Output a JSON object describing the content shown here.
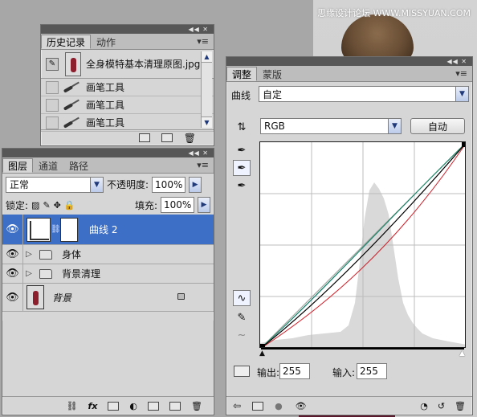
{
  "watermark": "思缘设计论坛 WWW.MISSYUAN.COM",
  "history": {
    "tabs": [
      "历史记录",
      "动作"
    ],
    "snapshot_name": "全身模特基本清理原图.jpg",
    "items": [
      "画笔工具",
      "画笔工具",
      "画笔工具"
    ]
  },
  "layers": {
    "tabs": [
      "图层",
      "通道",
      "路径"
    ],
    "blend_mode": "正常",
    "opacity_label": "不透明度:",
    "opacity_value": "100%",
    "lock_label": "锁定:",
    "fill_label": "填充:",
    "fill_value": "100%",
    "items": [
      {
        "name": "曲线 2",
        "kind": "adjustment",
        "selected": true
      },
      {
        "name": "身体",
        "kind": "group"
      },
      {
        "name": "背景清理",
        "kind": "group"
      },
      {
        "name": "背景",
        "kind": "background",
        "locked": true
      }
    ]
  },
  "adjust": {
    "tabs": [
      "调整",
      "蒙版"
    ],
    "type_label": "曲线",
    "preset_value": "自定",
    "channel_value": "RGB",
    "auto_label": "自动",
    "output_label": "输出:",
    "output_value": "255",
    "input_label": "输入:",
    "input_value": "255"
  },
  "colors": {
    "selection": "#3e6fc6",
    "curve_main": "#000000",
    "curve_red": "#d0202a",
    "curve_green": "#1e8c5a",
    "curve_blue": "#1f6dd0"
  }
}
